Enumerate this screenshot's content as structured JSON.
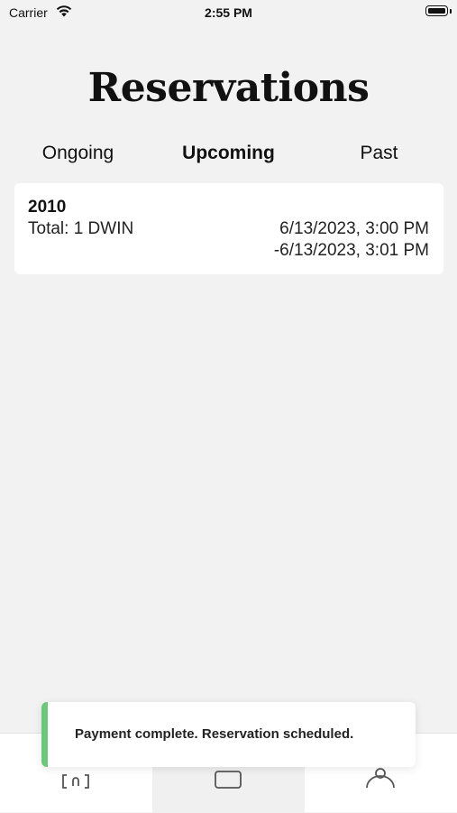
{
  "status_bar": {
    "carrier": "Carrier",
    "time": "2:55 PM"
  },
  "page": {
    "title": "Reservations"
  },
  "tabs": [
    {
      "label": "Ongoing",
      "active": false
    },
    {
      "label": "Upcoming",
      "active": true
    },
    {
      "label": "Past",
      "active": false
    }
  ],
  "reservations": [
    {
      "id": "2010",
      "total": "Total: 1 DWIN",
      "start": "6/13/2023, 3:00 PM",
      "end": "-6/13/2023, 3:01 PM"
    }
  ],
  "toast": {
    "message": "Payment complete. Reservation scheduled.",
    "accent_color": "#6cc77a"
  },
  "tab_bar": {
    "items": [
      {
        "icon": "scan-icon",
        "selected": false
      },
      {
        "icon": "reservations-icon",
        "selected": true
      },
      {
        "icon": "profile-icon",
        "selected": false
      }
    ]
  }
}
